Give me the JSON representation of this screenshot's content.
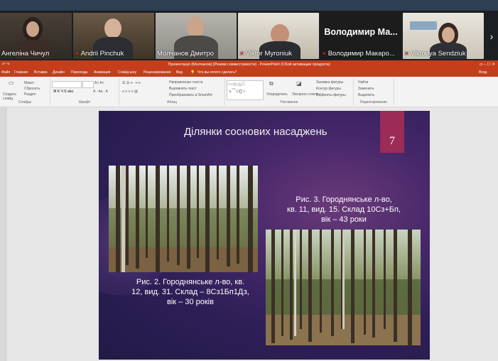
{
  "participants": [
    {
      "name": "Ангеліна Чичул",
      "muted": false
    },
    {
      "name": "Andrii Pinchuk",
      "muted": true
    },
    {
      "name": "Молчанов Дмитро",
      "muted": false
    },
    {
      "name": "Viktor Myroniuk",
      "muted": true
    },
    {
      "name": "Володимир Макаро...",
      "muted": true,
      "video_label": "Володимир Ма..."
    },
    {
      "name": "Viktoriya Sendziuk",
      "muted": true
    }
  ],
  "ppt": {
    "title": "Презентація (Молчанов) [Режим совместимости] - PowerPoint (Сбой активации продукта)",
    "signin": "Вход",
    "menu": [
      "Файл",
      "Главная",
      "Вставка",
      "Дизайн",
      "Переходы",
      "Анимация",
      "Слайд-шоу",
      "Рецензирование",
      "Вид"
    ],
    "tell_me": "Что вы хотите сделать?",
    "groups": {
      "slides": "Слайды",
      "font": "Шрифт",
      "paragraph": "Абзац",
      "drawing": "Рисование",
      "editing": "Редактирование"
    },
    "ribbon_items": {
      "new_slide": "Создать слайд",
      "layout": "Макет",
      "reset": "Сбросить",
      "section": "Раздел",
      "text_dir": "Направление текста",
      "align_text": "Выровнять текст",
      "smartart": "Преобразовать в SmartArt",
      "arrange": "Упорядочить",
      "quick_styles": "Экспресс-стили",
      "fill": "Заливка фигуры",
      "outline": "Контур фигуры",
      "effects": "Эффекты фигуры",
      "find": "Найти",
      "replace": "Заменить",
      "select": "Выделить"
    }
  },
  "slide": {
    "title": "Ділянки соснових насаджень",
    "number": "7",
    "caption1": [
      "Рис. 2. Городнянське л-во, кв.",
      "12, вид. 31. Склад – 8Сз1Бп1Дз,",
      "вік – 30 років"
    ],
    "caption2": [
      "Рис. 3. Городнянське л-во,",
      "кв. 11, вид. 15. Склад 10Сз+Бп,",
      "вік – 43 роки"
    ]
  }
}
